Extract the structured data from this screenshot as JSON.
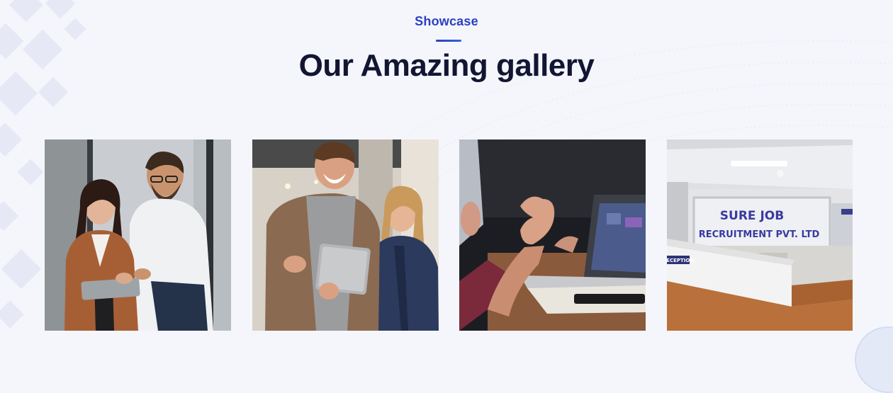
{
  "section": {
    "eyebrow": "Showcase",
    "title": "Our Amazing gallery"
  },
  "gallery": {
    "items": [
      {
        "name": "gallery-photo-colleagues-tablet"
      },
      {
        "name": "gallery-photo-team-tablet-smiling"
      },
      {
        "name": "gallery-photo-meeting-laptop"
      },
      {
        "name": "gallery-photo-reception-desk"
      }
    ],
    "reception_sign_line1": "SURE JOB",
    "reception_sign_line2": "RECRUITMENT PVT. LTD",
    "reception_label": "RECEPTION"
  },
  "colors": {
    "background": "#f5f6fb",
    "accent": "#2b3fc5",
    "heading": "#121633"
  }
}
